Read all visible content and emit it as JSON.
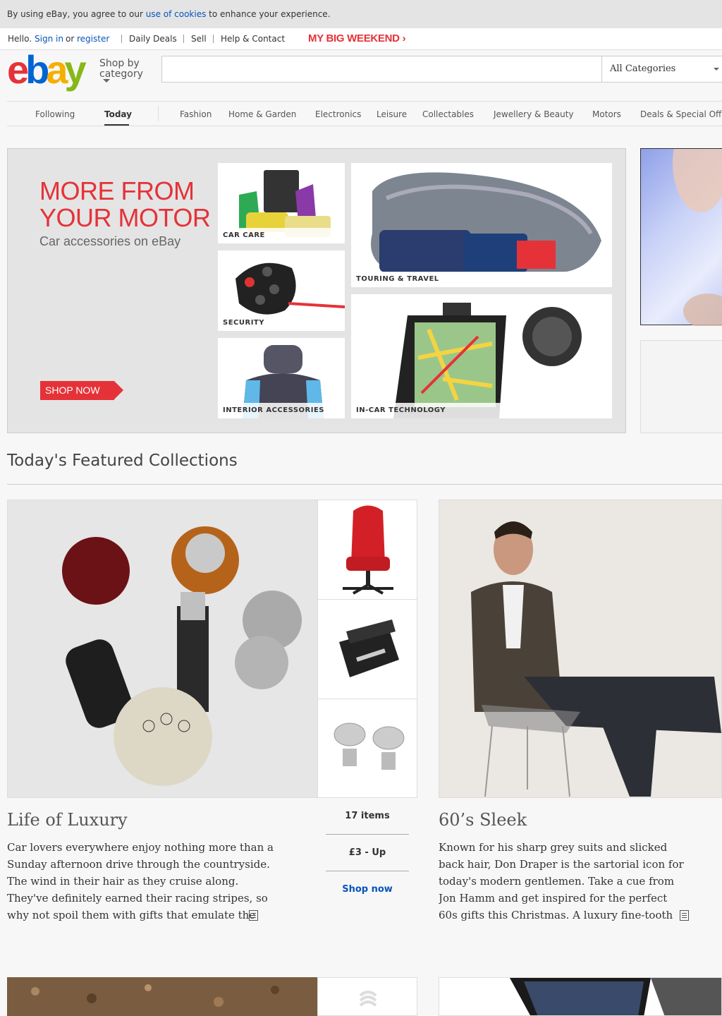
{
  "cookie_bar": {
    "text_before": "By using eBay, you agree to our ",
    "link": "use of cookies",
    "text_after": " to enhance your experience."
  },
  "topnav": {
    "hello": "Hello.",
    "sign_in": "Sign in",
    "or": "or",
    "register": "register",
    "daily_deals": "Daily Deals",
    "sell": "Sell",
    "help": "Help & Contact",
    "promo": "MY BIG WEEKEND ›"
  },
  "header": {
    "logo_letters": [
      "e",
      "b",
      "a",
      "y"
    ],
    "logo_colors": [
      "#e53238",
      "#0064d2",
      "#f5af02",
      "#86b817"
    ],
    "shop_by": "Shop by",
    "category": "category",
    "search_placeholder": "",
    "category_select": "All Categories"
  },
  "category_nav": [
    "Following",
    "Today",
    "Fashion",
    "Home & Garden",
    "Electronics",
    "Leisure",
    "Collectables",
    "Jewellery & Beauty",
    "Motors",
    "Deals & Special Off"
  ],
  "hero": {
    "title_line1": "MORE FROM",
    "title_line2": "YOUR MOTOR",
    "subtitle": "Car accessories on eBay",
    "cta": "SHOP NOW",
    "tiles": [
      "CAR CARE",
      "SECURITY",
      "INTERIOR ACCESSORIES",
      "TOURING & TRAVEL",
      "IN-CAR TECHNOLOGY"
    ]
  },
  "featured": {
    "heading": "Today's Featured Collections",
    "collections": [
      {
        "title": "Life of Luxury",
        "items": "17 items",
        "price": "£3 - Up",
        "link": "Shop now",
        "description": "Car lovers everywhere enjoy nothing more than a Sunday afternoon drive through the countryside. The wind in their hair as they cruise along. They've definitely earned their racing stripes, so why not spoil them with gifts that emulate the"
      },
      {
        "title": "60’s Sleek",
        "description": "Known for his sharp grey suits and slicked back hair, Don Draper is the sartorial icon for today's modern gentlemen. Take a cue from Jon Hamm and get inspired for the perfect 60s gifts this Christmas. A luxury fine-tooth comb or some"
      }
    ]
  }
}
